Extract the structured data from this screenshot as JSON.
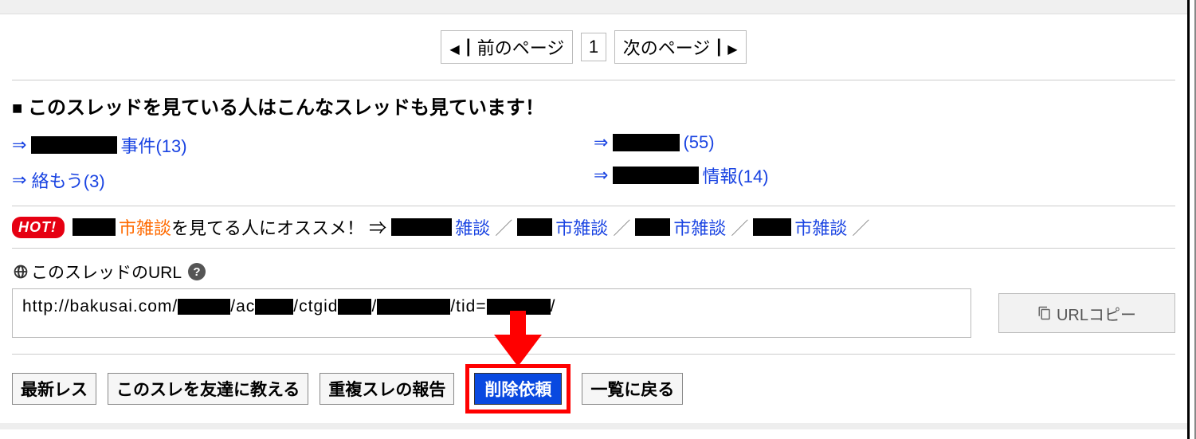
{
  "pagination": {
    "prev": "前のページ",
    "next": "次のページ",
    "current": "1"
  },
  "related_title": "このスレッドを見ている人はこんなスレッドも見ています！",
  "related": {
    "left": [
      {
        "suffix": "事件",
        "count": "(13)"
      },
      {
        "suffix": "絡もう",
        "count": "(3)",
        "no_block": true
      }
    ],
    "right": [
      {
        "suffix": "",
        "count": "(55)"
      },
      {
        "suffix": "情報",
        "count": "(14)"
      }
    ]
  },
  "recommend": {
    "hot": "HOT!",
    "topic": "市雑談",
    "tail": "を見てる人にオススメ！ ⇒",
    "links": [
      "雑談",
      "市雑談",
      "市雑談",
      "市雑談"
    ]
  },
  "url_section": {
    "label": "このスレッドのURL",
    "url_prefix": "http://bakusai.com/",
    "parts": [
      "/ac",
      "/ctgid",
      "/",
      "/tid=",
      "/"
    ],
    "copy": "URLコピー"
  },
  "bottom": {
    "latest": "最新レス",
    "share": "このスレを友達に教える",
    "dup": "重複スレの報告",
    "delete": "削除依頼",
    "back": "一覧に戻る"
  }
}
